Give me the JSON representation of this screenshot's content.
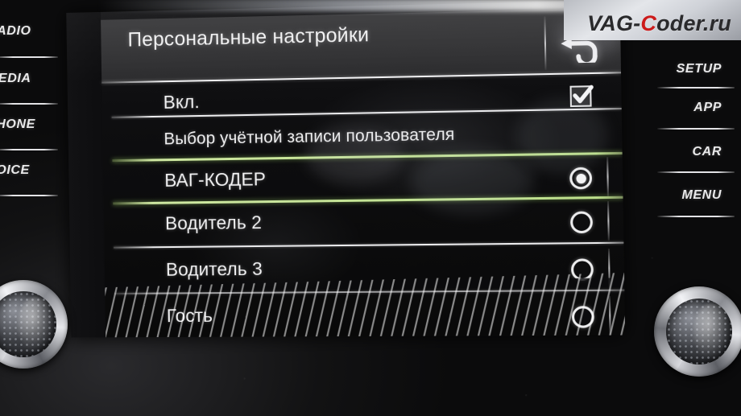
{
  "watermark": {
    "text_before": "VAG-",
    "accent": "C",
    "text_after": "oder.ru",
    "accent_color": "#cc1a1a"
  },
  "hardkeys": {
    "left": [
      {
        "label": "RADIO"
      },
      {
        "label": "MEDIA"
      },
      {
        "label": "PHONE"
      },
      {
        "label": "VOICE"
      }
    ],
    "right": [
      {
        "label": "SETUP"
      },
      {
        "label": "APP"
      },
      {
        "label": "CAR"
      },
      {
        "label": "MENU"
      }
    ]
  },
  "screen": {
    "title": "Персональные настройки",
    "back_icon": "back-arrow-icon",
    "rows": [
      {
        "label": "Вкл.",
        "type": "checkbox",
        "checked": true
      },
      {
        "label": "Выбор учётной записи пользователя",
        "type": "section-header"
      },
      {
        "label": "ВАГ-КОДЕР",
        "type": "radio",
        "selected": true,
        "chevron": ">",
        "highlighted": true
      },
      {
        "label": "Водитель 2",
        "type": "radio",
        "selected": false,
        "chevron": ">"
      },
      {
        "label": "Водитель 3",
        "type": "radio",
        "selected": false,
        "chevron": ">"
      },
      {
        "label": "Гость",
        "type": "radio",
        "selected": false,
        "chevron": ">"
      }
    ],
    "highlight_color": "#c3e394",
    "scrollbar": {
      "visible": true
    }
  },
  "knobs": [
    {
      "name": "left-rotary-knob"
    },
    {
      "name": "right-rotary-knob"
    }
  ]
}
